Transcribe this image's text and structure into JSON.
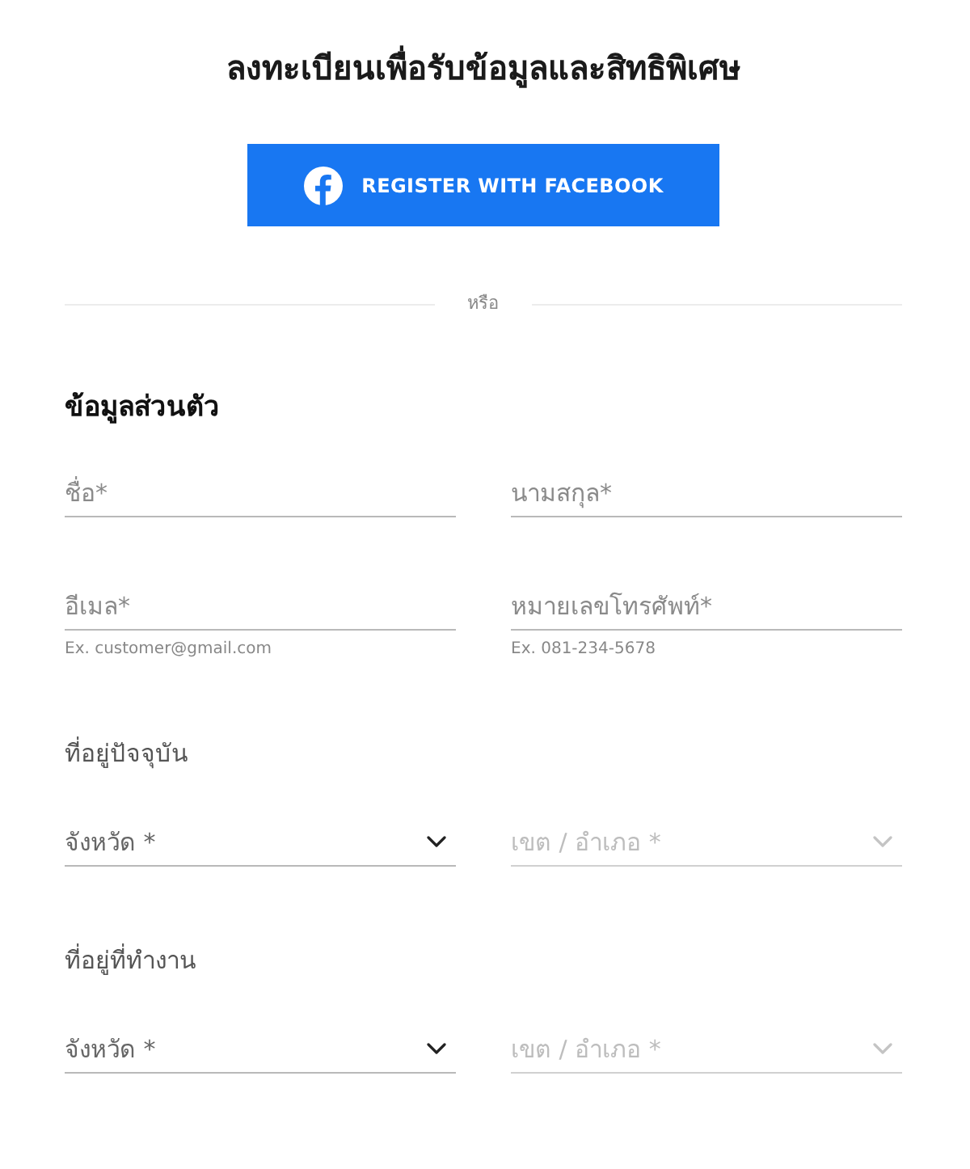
{
  "title": "ลงทะเบียนเพื่อรับข้อมูลและสิทธิพิเศษ",
  "facebook_button": {
    "label": "REGISTER WITH FACEBOOK"
  },
  "divider": {
    "label": "หรือ"
  },
  "sections": [
    {
      "kind": "section",
      "heading": "ข้อมูลส่วนตัว",
      "fields": [
        {
          "kind": "text",
          "placeholder": "ชื่อ*"
        },
        {
          "kind": "text",
          "placeholder": "นามสกุล*"
        },
        {
          "kind": "text",
          "placeholder": "อีเมล*",
          "hint": "Ex. customer@gmail.com"
        },
        {
          "kind": "text",
          "placeholder": "หมายเลขโทรศัพท์*",
          "hint": "Ex. 081-234-5678"
        }
      ]
    },
    {
      "kind": "subsection",
      "heading": "ที่อยู่ปัจจุบัน",
      "fields": [
        {
          "kind": "select",
          "placeholder": "จังหวัด *",
          "disabled": false
        },
        {
          "kind": "select",
          "placeholder": "เขต / อำเภอ *",
          "disabled": true
        }
      ]
    },
    {
      "kind": "subsection",
      "heading": "ที่อยู่ที่ทำงาน",
      "fields": [
        {
          "kind": "select",
          "placeholder": "จังหวัด *",
          "disabled": false
        },
        {
          "kind": "select",
          "placeholder": "เขต / อำเภอ *",
          "disabled": true
        }
      ]
    }
  ]
}
